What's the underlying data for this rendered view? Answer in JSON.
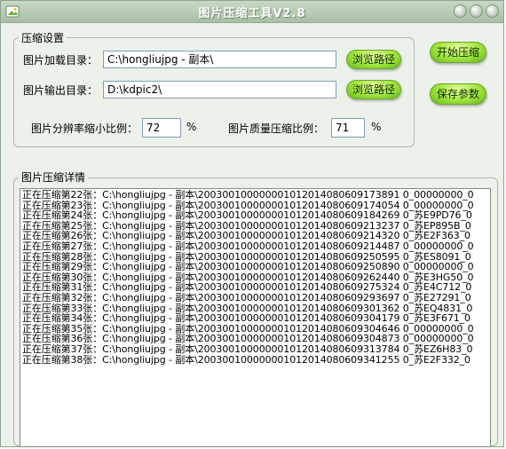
{
  "window": {
    "title": "图片压缩工具V2.8"
  },
  "settings": {
    "legend": "压缩设置",
    "input_label": "图片加载目录：",
    "input_value": "C:\\hongliujpg - 副本\\",
    "output_label": "图片输出目录：",
    "output_value": "D:\\kdpic2\\",
    "browse_label": "浏览路径",
    "resolution_label": "图片分辨率缩小比例：",
    "resolution_value": "72",
    "quality_label": "图片质量压缩比例：",
    "quality_value": "71",
    "percent": "%"
  },
  "actions": {
    "start_label": "开始压缩",
    "save_label": "保存参数"
  },
  "details": {
    "legend": "图片压缩详情",
    "lines": [
      "正在压缩第22张：C:\\hongliujpg - 副本\\200300100000001012014080609173891 0_00000000_0",
      "正在压缩第23张：C:\\hongliujpg - 副本\\200300100000001012014080609174054 0_00000000_0",
      "正在压缩第24张：C:\\hongliujpg - 副本\\200300100000001012014080609184269 0_苏E9PD76_0",
      "正在压缩第25张：C:\\hongliujpg - 副本\\200300100000001012014080609213237 0_苏EP895B_0",
      "正在压缩第26张：C:\\hongliujpg - 副本\\200300100000001012014080609214320 0_苏E2F363_0",
      "正在压缩第27张：C:\\hongliujpg - 副本\\200300100000001012014080609214487 0_00000000_0",
      "正在压缩第28张：C:\\hongliujpg - 副本\\200300100000001012014080609250595 0_苏ES8091_0",
      "正在压缩第29张：C:\\hongliujpg - 副本\\200300100000001012014080609250890 0_00000000_0",
      "正在压缩第30张：C:\\hongliujpg - 副本\\200300100000001012014080609262440 0_苏E3HG50_0",
      "正在压缩第31张：C:\\hongliujpg - 副本\\200300100000001012014080609275324 0_苏E4C712_0",
      "正在压缩第32张：C:\\hongliujpg - 副本\\200300100000001012014080609293697 0_苏E27291_0",
      "正在压缩第33张：C:\\hongliujpg - 副本\\200300100000001012014080609301362 0_苏EQ4831_0",
      "正在压缩第34张：C:\\hongliujpg - 副本\\200300100000001012014080609304179 0_苏E3F671_0",
      "正在压缩第35张：C:\\hongliujpg - 副本\\200300100000001012014080609304646 0_00000000_0",
      "正在压缩第36张：C:\\hongliujpg - 副本\\200300100000001012014080609304873 0_00000000_0",
      "正在压缩第37张：C:\\hongliujpg - 副本\\200300100000001012014080609313784 0_苏EZ6H83_0",
      "正在压缩第38张：C:\\hongliujpg - 副本\\200300100000001012014080609341255 0_苏E2F332_0"
    ]
  }
}
